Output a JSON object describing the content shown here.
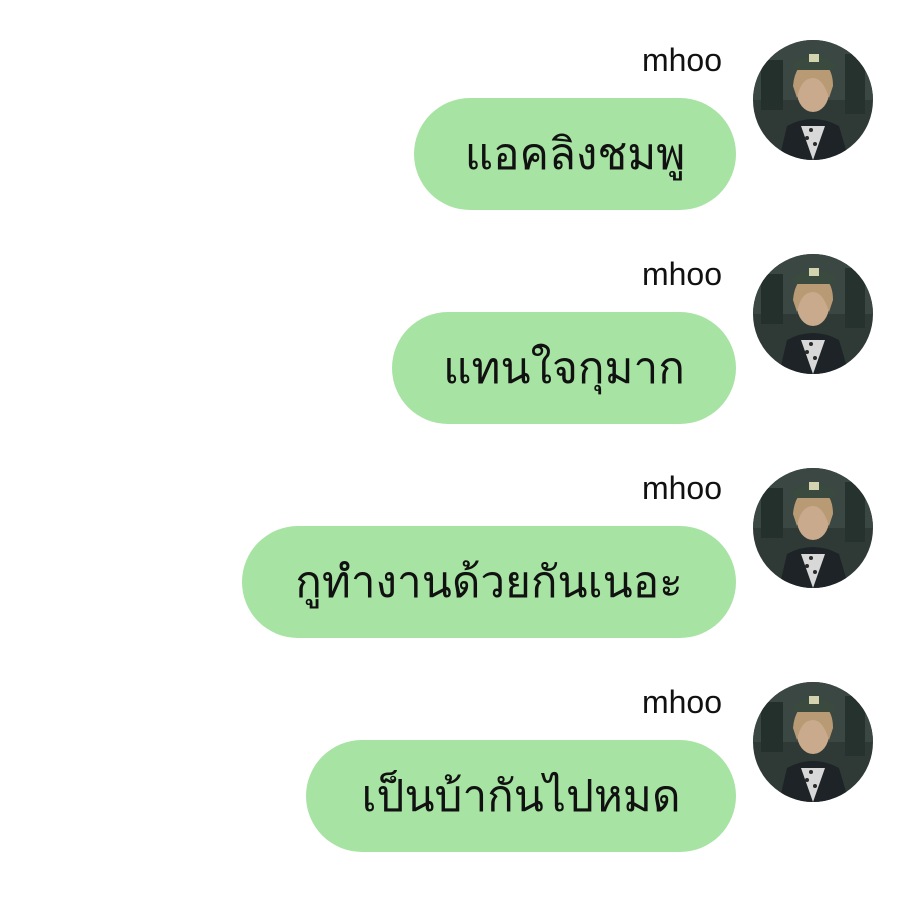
{
  "theme": {
    "bubble_color": "#a7e3a3",
    "text_color": "#111111",
    "background": "#ffffff"
  },
  "messages": [
    {
      "sender": "mhoo",
      "text": "แอคลิงชมพู",
      "avatar_icon": "profile-photo"
    },
    {
      "sender": "mhoo",
      "text": "แทนใจกุมาก",
      "avatar_icon": "profile-photo"
    },
    {
      "sender": "mhoo",
      "text": "กูทำงานด้วยกันเนอะ",
      "avatar_icon": "profile-photo"
    },
    {
      "sender": "mhoo",
      "text": "เป็นบ้ากันไปหมด",
      "avatar_icon": "profile-photo"
    }
  ]
}
